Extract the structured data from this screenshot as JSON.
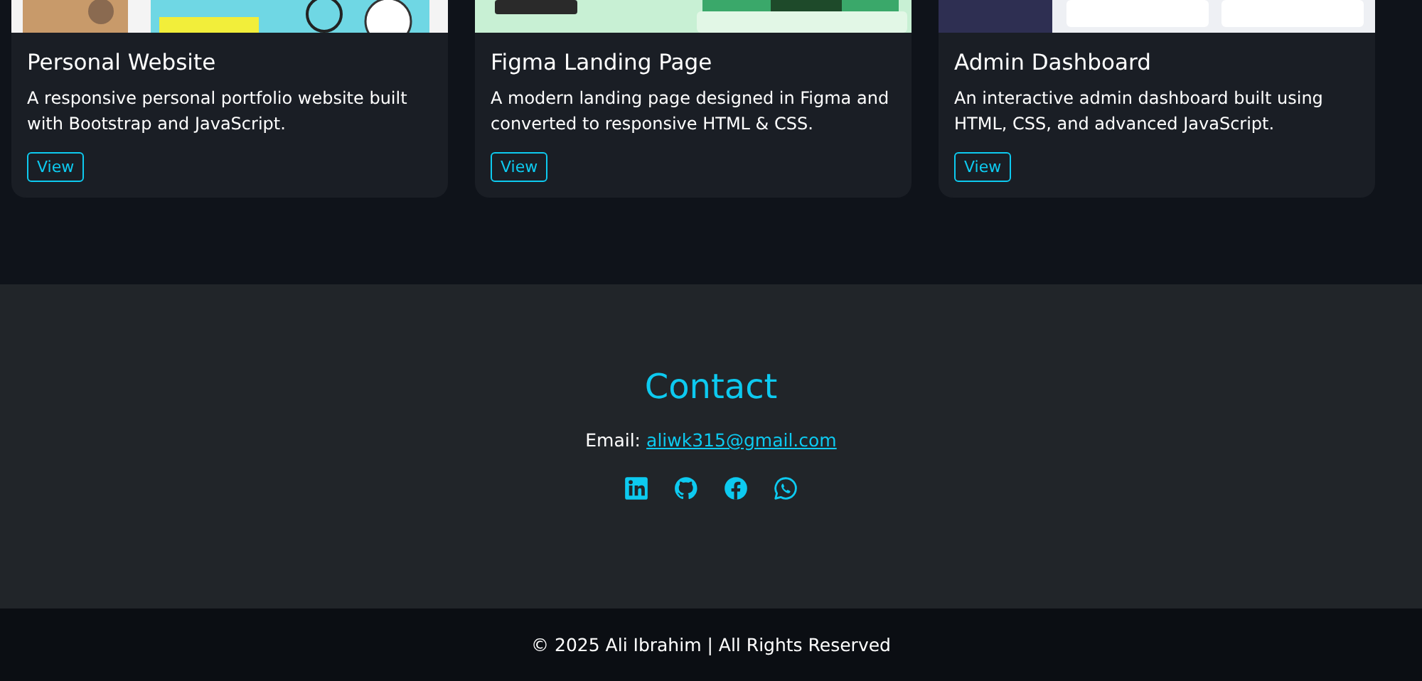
{
  "projects": [
    {
      "title": "Personal Website",
      "description": "A responsive personal portfolio website built with Bootstrap and JavaScript.",
      "button": "View"
    },
    {
      "title": "Figma Landing Page",
      "description": "A modern landing page designed in Figma and converted to responsive HTML & CSS.",
      "button": "View"
    },
    {
      "title": "Admin Dashboard",
      "description": "An interactive admin dashboard built using HTML, CSS, and advanced JavaScript.",
      "button": "View"
    }
  ],
  "contact": {
    "heading": "Contact",
    "email_label": "Email:",
    "email": "aliwk315@gmail.com",
    "socials": [
      {
        "kind": "linkedin"
      },
      {
        "kind": "github"
      },
      {
        "kind": "facebook"
      },
      {
        "kind": "whatsapp"
      }
    ]
  },
  "footer": "© 2025 Ali Ibrahim | All Rights Reserved"
}
